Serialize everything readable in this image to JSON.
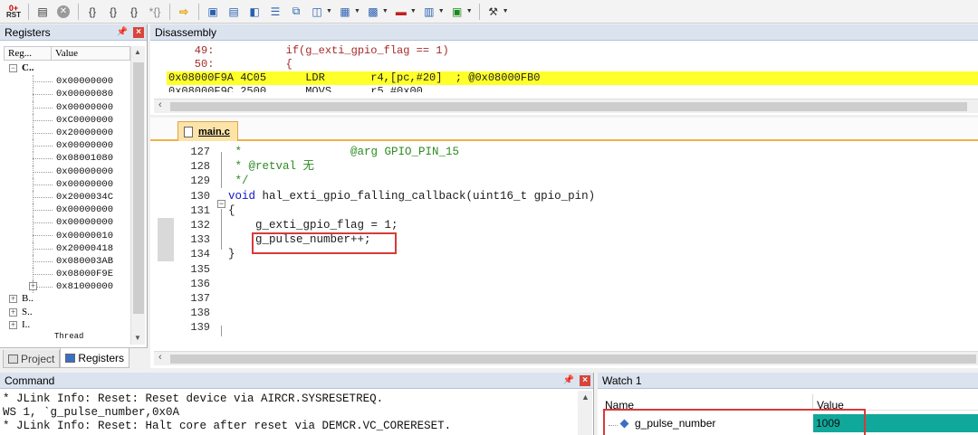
{
  "toolbar": {
    "rst_top": "0+",
    "rst_label": "RST",
    "icons": [
      "reset-icon",
      "run-icon",
      "stop-icon",
      "step-into-icon",
      "step-over-icon",
      "step-out-icon",
      "run-to-cursor-icon",
      "show-next-statement-icon",
      "command-window-icon",
      "disassembly-window-icon",
      "symbols-window-icon",
      "registers-window-icon",
      "call-stack-icon",
      "watch-windows-icon",
      "memory-windows-icon",
      "serial-windows-icon",
      "analysis-windows-icon",
      "trace-windows-icon",
      "system-viewer-icon",
      "toolbox-icon"
    ]
  },
  "registers": {
    "title": "Registers",
    "col_register": "Reg...",
    "col_value": "Value",
    "group_core": "C..",
    "values": [
      "0x00000000",
      "0x00000080",
      "0x00000000",
      "0xC0000000",
      "0x20000000",
      "0x00000000",
      "0x08001080",
      "0x00000000",
      "0x00000000",
      "0x2000034C",
      "0x00000000",
      "0x00000000",
      "0x00000010",
      "0x20000418",
      "0x080003AB",
      "0x08000F9E",
      "0x81000000"
    ],
    "groups_collapsed": [
      "B..",
      "S..",
      "I.."
    ],
    "partial_item": "Thread",
    "tab_project": "Project",
    "tab_registers": "Registers"
  },
  "disassembly": {
    "title": "Disassembly",
    "lines": [
      {
        "text": "    49:           if(g_exti_gpio_flag == 1)",
        "kind": "src"
      },
      {
        "text": "    50:           {",
        "kind": "src"
      },
      {
        "text": "0x08000F9A 4C05      LDR       r4,[pc,#20]  ; @0x08000FB0",
        "kind": "current"
      },
      {
        "text": "0x08000F9C 2500      MOVS      r5,#0x00",
        "kind": "asm"
      }
    ]
  },
  "editor": {
    "tab_name": "main.c",
    "line_numbers": [
      "127",
      "128",
      "129",
      "130",
      "131",
      "132",
      "133",
      "134",
      "135",
      "136",
      "137",
      "138",
      "139"
    ],
    "code_lines": [
      " *                @arg GPIO_PIN_15",
      " * @retval 无",
      " */",
      "void hal_exti_gpio_falling_callback(uint16_t gpio_pin)",
      "{",
      "    g_exti_gpio_flag = 1;",
      "    g_pulse_number++;",
      "}",
      "",
      "",
      "",
      "",
      ""
    ]
  },
  "command": {
    "title": "Command",
    "lines": [
      "* JLink Info: Reset: Reset device via AIRCR.SYSRESETREQ.",
      "WS 1, `g_pulse_number,0x0A",
      "* JLink Info: Reset: Halt core after reset via DEMCR.VC_CORERESET."
    ]
  },
  "watch": {
    "title": "Watch 1",
    "col_name": "Name",
    "col_value": "Value",
    "row_name": "g_pulse_number",
    "row_value": "1009"
  },
  "colors": {
    "current_line": "#ffff29",
    "highlight_box": "#d83a3a",
    "watch_value_bg": "#0fa89a",
    "comment": "#2e8b22",
    "keyword": "#1414c8"
  }
}
